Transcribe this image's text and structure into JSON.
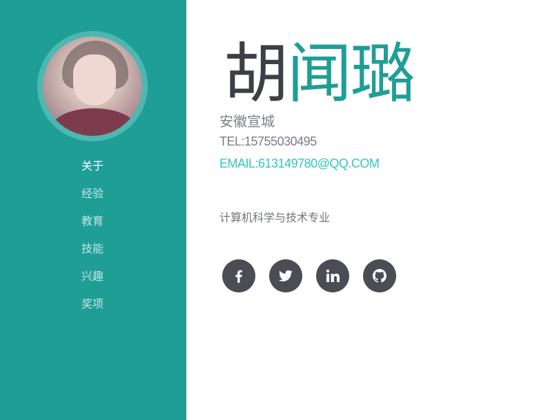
{
  "colors": {
    "sidebar": "#1f9e96",
    "accent": "#1f9e96",
    "email": "#2fc7bd",
    "dark": "#3c3f45",
    "social": "#4a4d53"
  },
  "nav": {
    "items": [
      {
        "label": "关于",
        "active": true
      },
      {
        "label": "经验"
      },
      {
        "label": "教育"
      },
      {
        "label": "技能"
      },
      {
        "label": "兴趣"
      },
      {
        "label": "奖项"
      }
    ]
  },
  "profile": {
    "first_name": "胡",
    "last_name": "闻璐",
    "location": "安徽宣城",
    "tel": "TEL:15755030495",
    "email": "EMAIL:613149780@QQ.COM",
    "major": "计算机科学与技术专业"
  },
  "social": [
    {
      "icon": "facebook-icon"
    },
    {
      "icon": "twitter-icon"
    },
    {
      "icon": "linkedin-icon"
    },
    {
      "icon": "github-icon"
    }
  ]
}
